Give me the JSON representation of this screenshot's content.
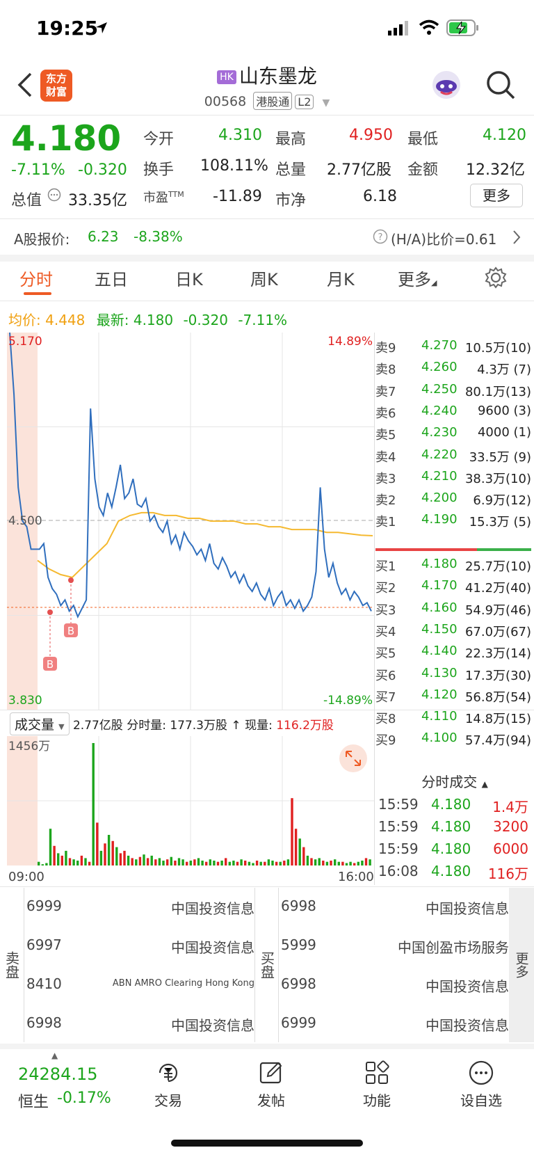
{
  "status_bar": {
    "time": "19:25"
  },
  "header": {
    "logo_text": "东方\n财富",
    "market_tag": "HK",
    "name": "山东墨龙",
    "code": "00568",
    "connect_tag": "港股通",
    "level_tag": "L2"
  },
  "quote": {
    "price": "4.180",
    "change_pct": "-7.11%",
    "change": "-0.320",
    "fields": {
      "open_label": "今开",
      "open": "4.310",
      "high_label": "最高",
      "high": "4.950",
      "low_label": "最低",
      "low": "4.120",
      "turnover_label": "换手",
      "turnover": "108.11%",
      "volume_label": "总量",
      "volume": "2.77亿股",
      "amount_label": "金额",
      "amount": "12.32亿",
      "mktcap_label": "总值",
      "mktcap": "33.35亿",
      "pe_label": "市盈",
      "pe_sup": "TTM",
      "pe": "-11.89",
      "pb_label": "市净",
      "pb": "6.18"
    },
    "more_button": "更多"
  },
  "a_share": {
    "label": "A股报价:",
    "price": "6.23",
    "change": "-8.38%",
    "ratio": "(H/A)比价=0.61"
  },
  "tabs": [
    "分时",
    "五日",
    "日K",
    "周K",
    "月K",
    "更多"
  ],
  "chart_header": {
    "avg_label": "均价:",
    "avg": "4.448",
    "last_label": "最新:",
    "last": "4.180",
    "chg": "-0.320",
    "chg_pct": "-7.11%"
  },
  "chart_labels": {
    "y_top": "5.170",
    "y_mid": "4.500",
    "y_bottom": "3.830",
    "pct_top": "14.89%",
    "pct_bottom": "-14.89%",
    "marker": "B"
  },
  "chart_data": {
    "type": "line",
    "xlim": [
      "09:00",
      "16:00"
    ],
    "ylim": [
      3.83,
      5.17
    ],
    "series": [
      {
        "values": [
          5.17,
          4.95,
          4.62,
          4.5,
          4.48,
          4.4,
          4.4,
          4.4,
          4.42,
          4.3,
          4.26,
          4.24,
          4.2,
          4.22,
          4.18,
          4.2,
          4.16,
          4.19,
          4.22,
          4.9,
          4.65,
          4.55,
          4.52,
          4.6,
          4.55,
          4.62,
          4.7,
          4.58,
          4.6,
          4.65,
          4.56,
          4.55,
          4.58,
          4.5,
          4.52,
          4.48,
          4.46,
          4.5,
          4.42,
          4.45,
          4.4,
          4.46,
          4.43,
          4.41,
          4.38,
          4.4,
          4.36,
          4.42,
          4.35,
          4.33,
          4.37,
          4.34,
          4.3,
          4.32,
          4.28,
          4.31,
          4.27,
          4.25,
          4.28,
          4.24,
          4.22,
          4.26,
          4.2,
          4.23,
          4.25,
          4.2,
          4.22,
          4.19,
          4.22,
          4.18,
          4.2,
          4.23,
          4.32,
          4.62,
          4.4,
          4.3,
          4.35,
          4.28,
          4.24,
          4.26,
          4.22,
          4.25,
          4.23,
          4.2,
          4.21,
          4.18
        ]
      },
      {
        "values": [
          4.36,
          4.33,
          4.31,
          4.3,
          4.34,
          4.38,
          4.42,
          4.5,
          4.52,
          4.53,
          4.53,
          4.52,
          4.52,
          4.51,
          4.51,
          4.5,
          4.5,
          4.5,
          4.49,
          4.49,
          4.48,
          4.48,
          4.47,
          4.47,
          4.47,
          4.46,
          4.46,
          4.455,
          4.45,
          4.448
        ]
      }
    ]
  },
  "volume": {
    "selector": "成交量",
    "total": "2.77亿股",
    "minute_label": "分时量: 177.3万股",
    "arrow": "↑",
    "current_label": "现量:",
    "current": "116.2万股",
    "y_max": "1456万",
    "x_start": "09:00",
    "x_end": "16:00",
    "bars": [
      3,
      1,
      2,
      30,
      16,
      10,
      8,
      12,
      6,
      5,
      4,
      8,
      6,
      3,
      100,
      35,
      12,
      18,
      25,
      20,
      15,
      10,
      12,
      8,
      6,
      5,
      7,
      9,
      6,
      8,
      5,
      6,
      4,
      5,
      7,
      4,
      6,
      5,
      3,
      4,
      5,
      6,
      4,
      3,
      5,
      4,
      3,
      4,
      6,
      3,
      4,
      3,
      5,
      4,
      3,
      2,
      4,
      3,
      3,
      5,
      4,
      3,
      3,
      4,
      5,
      55,
      30,
      22,
      15,
      8,
      6,
      5,
      6,
      4,
      3,
      4,
      5,
      3,
      3,
      2,
      3,
      2,
      3,
      4,
      6,
      5
    ],
    "bar_colors": [
      "g",
      "g",
      "g",
      "g",
      "r",
      "g",
      "r",
      "g",
      "r",
      "g",
      "g",
      "r",
      "g",
      "r",
      "g",
      "r",
      "g",
      "r",
      "g",
      "r",
      "g",
      "r",
      "r",
      "g",
      "r",
      "g",
      "r",
      "g",
      "r",
      "g",
      "r",
      "g",
      "g",
      "r",
      "g",
      "r",
      "g",
      "g",
      "r",
      "g",
      "r",
      "g",
      "g",
      "r",
      "g",
      "g",
      "r",
      "g",
      "r",
      "g",
      "g",
      "r",
      "g",
      "r",
      "g",
      "g",
      "r",
      "g",
      "r",
      "g",
      "g",
      "r",
      "g",
      "r",
      "g",
      "r",
      "r",
      "g",
      "r",
      "g",
      "r",
      "g",
      "g",
      "r",
      "g",
      "r",
      "g",
      "g",
      "r",
      "g",
      "g",
      "r",
      "g",
      "g",
      "r",
      "g"
    ]
  },
  "order_book": {
    "asks": [
      {
        "label": "卖9",
        "price": "4.270",
        "vol": "10.5万(10)"
      },
      {
        "label": "卖8",
        "price": "4.260",
        "vol": "4.3万 (7)"
      },
      {
        "label": "卖7",
        "price": "4.250",
        "vol": "80.1万(13)"
      },
      {
        "label": "卖6",
        "price": "4.240",
        "vol": "9600 (3)"
      },
      {
        "label": "卖5",
        "price": "4.230",
        "vol": "4000 (1)"
      },
      {
        "label": "卖4",
        "price": "4.220",
        "vol": "33.5万 (9)"
      },
      {
        "label": "卖3",
        "price": "4.210",
        "vol": "38.3万(10)"
      },
      {
        "label": "卖2",
        "price": "4.200",
        "vol": "6.9万(12)"
      },
      {
        "label": "卖1",
        "price": "4.190",
        "vol": "15.3万 (5)"
      }
    ],
    "bids": [
      {
        "label": "买1",
        "price": "4.180",
        "vol": "25.7万(10)"
      },
      {
        "label": "买2",
        "price": "4.170",
        "vol": "41.2万(40)"
      },
      {
        "label": "买3",
        "price": "4.160",
        "vol": "54.9万(46)"
      },
      {
        "label": "买4",
        "price": "4.150",
        "vol": "67.0万(67)"
      },
      {
        "label": "买5",
        "price": "4.140",
        "vol": "22.3万(14)"
      },
      {
        "label": "买6",
        "price": "4.130",
        "vol": "17.3万(30)"
      },
      {
        "label": "买7",
        "price": "4.120",
        "vol": "56.8万(54)"
      },
      {
        "label": "买8",
        "price": "4.110",
        "vol": "14.8万(15)"
      },
      {
        "label": "买9",
        "price": "4.100",
        "vol": "57.4万(94)"
      }
    ]
  },
  "ticks": {
    "title": "分时成交",
    "rows": [
      {
        "time": "15:59",
        "price": "4.180",
        "vol": "1.4万"
      },
      {
        "time": "15:59",
        "price": "4.180",
        "vol": "3200"
      },
      {
        "time": "15:59",
        "price": "4.180",
        "vol": "6000"
      },
      {
        "time": "16:08",
        "price": "4.180",
        "vol": "116万"
      }
    ]
  },
  "brokers": {
    "sell_label": "卖盘",
    "buy_label": "买盘",
    "more": "更多",
    "sell": [
      {
        "id": "6999",
        "name": "中国投资信息"
      },
      {
        "id": "6997",
        "name": "中国投资信息"
      },
      {
        "id": "8410",
        "name": "ABN AMRO Clearing Hong Kong"
      },
      {
        "id": "6998",
        "name": "中国投资信息"
      }
    ],
    "buy": [
      {
        "id": "6998",
        "name": "中国投资信息"
      },
      {
        "id": "5999",
        "name": "中国创盈市场服务"
      },
      {
        "id": "6998",
        "name": "中国投资信息"
      },
      {
        "id": "6999",
        "name": "中国投资信息"
      }
    ]
  },
  "footer": {
    "index_value": "24284.15",
    "index_name": "恒生",
    "index_change": "-0.17%",
    "items": [
      "交易",
      "发帖",
      "功能",
      "设自选"
    ]
  }
}
